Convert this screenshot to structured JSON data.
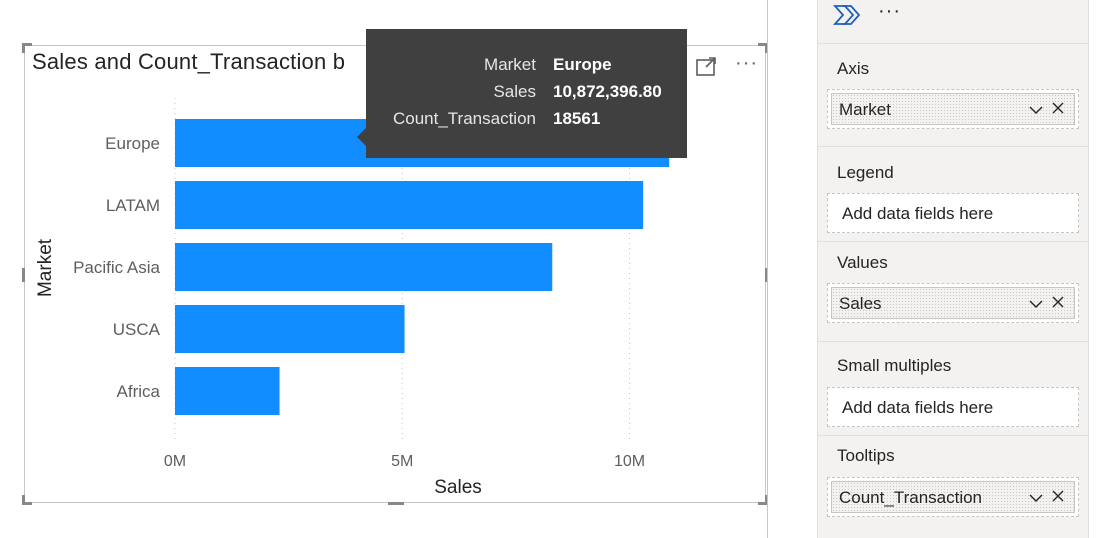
{
  "visual": {
    "title": "Sales and Count_Transaction b",
    "focus_icon": "focus-mode-icon",
    "more_icon": "more-options-icon",
    "more_label": "···"
  },
  "chart_data": {
    "type": "bar",
    "orientation": "horizontal",
    "categories": [
      "Europe",
      "LATAM",
      "Pacific Asia",
      "USCA",
      "Africa"
    ],
    "series": [
      {
        "values": [
          10872396.8,
          10300000,
          8300000,
          5050000,
          2300000
        ]
      }
    ],
    "x_ticks": [
      "0M",
      "5M",
      "10M"
    ],
    "x_tick_values": [
      0,
      5000000,
      10000000
    ],
    "xlabel": "Sales",
    "ylabel": "Market",
    "xlim": [
      0,
      11000000
    ],
    "grid": "vertical-dotted",
    "bar_color": "#118dff"
  },
  "tooltip": {
    "rows": [
      {
        "key": "Market",
        "value": "Europe"
      },
      {
        "key": "Sales",
        "value": "10,872,396.80"
      },
      {
        "key": "Count_Transaction",
        "value": "18561"
      }
    ]
  },
  "pane": {
    "build_icon": "build-visual-icon",
    "more_label": "···",
    "wells": [
      {
        "label": "Axis",
        "field": "Market"
      },
      {
        "label": "Legend",
        "placeholder": "Add data fields here"
      },
      {
        "label": "Values",
        "field": "Sales"
      },
      {
        "label": "Small multiples",
        "placeholder": "Add data fields here"
      },
      {
        "label": "Tooltips",
        "field": "Count_Transaction"
      }
    ]
  },
  "colors": {
    "bar": "#118dff",
    "tooltip_bg": "#404040",
    "pane_bg": "#f3f2f1"
  }
}
